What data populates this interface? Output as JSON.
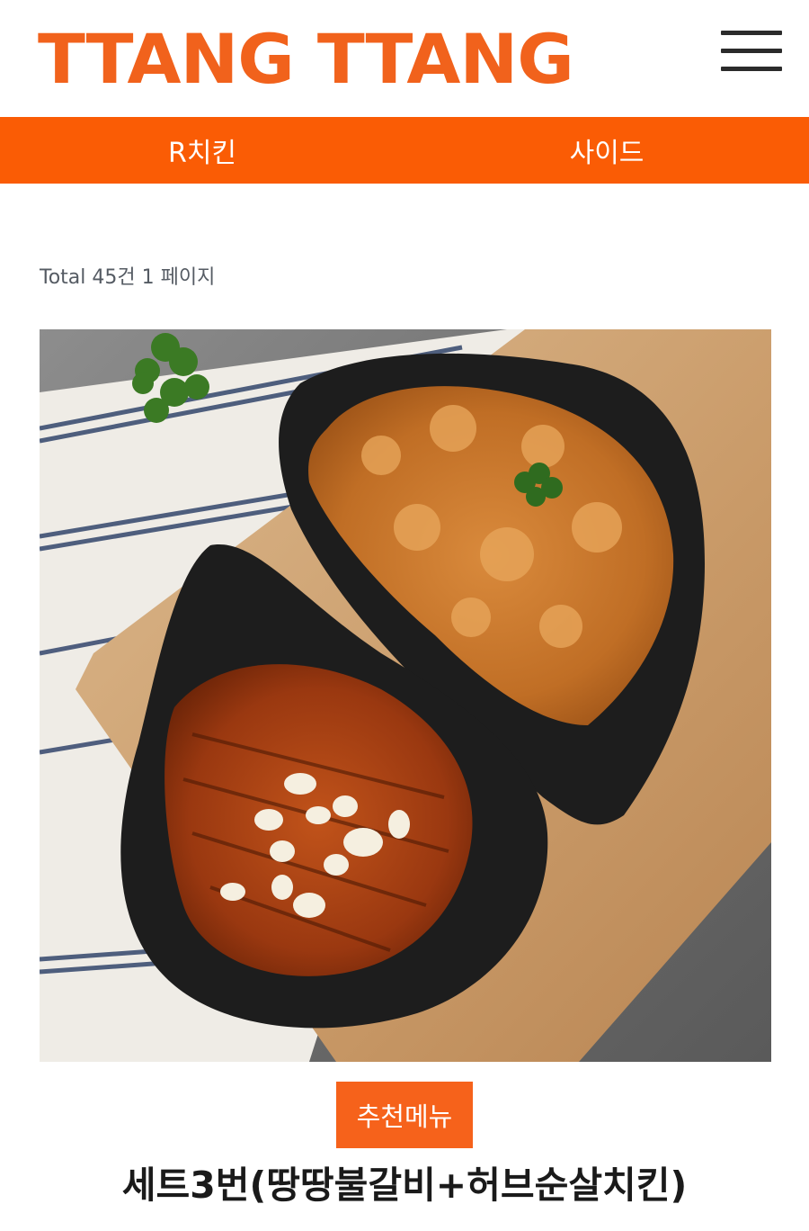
{
  "header": {
    "logo_text": "TTANG TTANG",
    "menu_icon": "hamburger-menu-icon"
  },
  "nav": {
    "items": [
      {
        "label": "R치킨"
      },
      {
        "label": "사이드"
      }
    ]
  },
  "listing": {
    "total_text": "Total 45건 1 페이지"
  },
  "product": {
    "image": "chicken-set-photo",
    "badge": "추천메뉴",
    "title": "세트3번(땅땅불갈비+허브순살치킨)"
  },
  "colors": {
    "brand_orange": "#f1621c",
    "nav_orange": "#fa5c05",
    "badge_orange": "#f6621b"
  }
}
